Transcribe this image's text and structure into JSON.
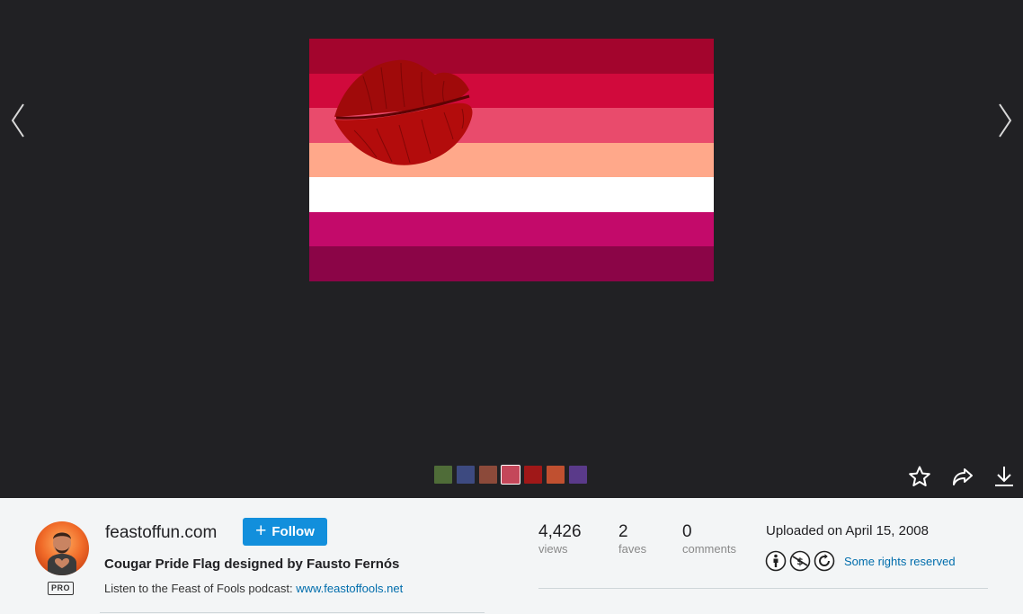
{
  "viewer": {
    "flag_stripes": [
      "#a3052d",
      "#d10a3c",
      "#e94b6c",
      "#ffa88a",
      "#ffffff",
      "#c30a6a",
      "#8b0547"
    ],
    "thumbnails": [
      {
        "color": "#4f6c38",
        "active": false
      },
      {
        "color": "#3d4a80",
        "active": false
      },
      {
        "color": "#8c4a3a",
        "active": false
      },
      {
        "color": "#c4475a",
        "active": true
      },
      {
        "color": "#a01818",
        "active": false
      },
      {
        "color": "#c05030",
        "active": false
      },
      {
        "color": "#5a3a8a",
        "active": false
      }
    ],
    "icons": {
      "prev": "chevron-left-icon",
      "next": "chevron-right-icon",
      "fave": "star-icon",
      "share": "share-arrow-icon",
      "download": "download-icon"
    }
  },
  "owner": {
    "name": "feastoffun.com",
    "badge": "PRO",
    "follow_label": "Follow"
  },
  "photo": {
    "title": "Cougar Pride Flag designed by Fausto Fernós",
    "description_prefix": "Listen to the Feast of Fools podcast: ",
    "description_link": "www.feastoffools.net"
  },
  "stats": {
    "views": {
      "value": "4,426",
      "label": "views"
    },
    "faves": {
      "value": "2",
      "label": "faves"
    },
    "comments": {
      "value": "0",
      "label": "comments"
    }
  },
  "meta": {
    "uploaded": "Uploaded on April 15, 2008",
    "license_label": "Some rights reserved",
    "license_icons": [
      "cc-by-icon",
      "cc-nc-icon",
      "cc-sa-icon"
    ]
  },
  "colors": {
    "viewer_bg": "#212124",
    "panel_bg": "#f3f5f6",
    "accent": "#128fdc",
    "link": "#006dac"
  }
}
